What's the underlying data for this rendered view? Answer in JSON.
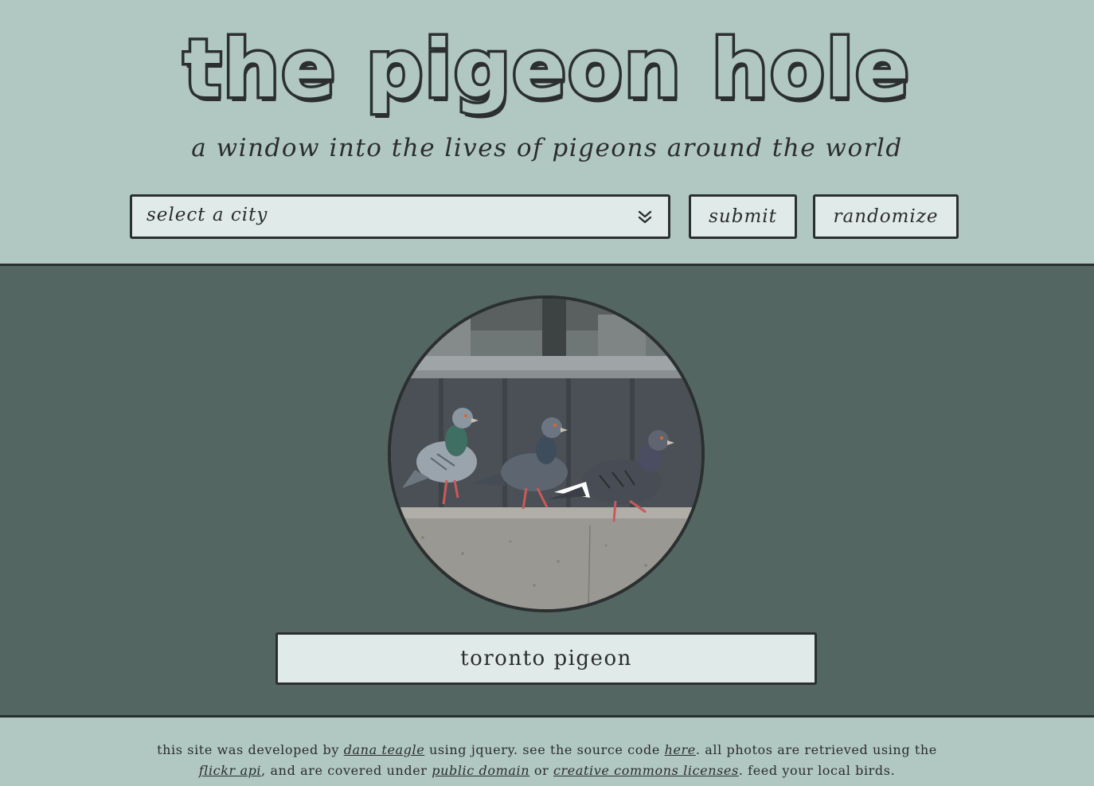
{
  "header": {
    "title": "the pigeon hole",
    "tagline": "a window into the lives of pigeons around the world"
  },
  "controls": {
    "city_select_placeholder": "select a city",
    "submit_label": "submit",
    "randomize_label": "randomize"
  },
  "main": {
    "photo_caption": "toronto pigeon"
  },
  "footer": {
    "text_1": "this site was developed by ",
    "link_author": "dana teagle",
    "text_2": " using jquery. see the source code ",
    "link_source": "here",
    "text_3": ". all photos are retrieved using the ",
    "link_flickr": "flickr api",
    "text_4": ", and are covered under ",
    "link_public_domain": "public domain",
    "text_5": " or ",
    "link_cc": "creative commons licenses",
    "text_6": ". feed your local birds."
  },
  "icons": {
    "select_chevron": "double-chevron-down-icon"
  },
  "colors": {
    "background": "#b1c8c2",
    "main_panel": "#536661",
    "box_fill": "#e0ebe9",
    "ink": "#2b2f2f"
  }
}
